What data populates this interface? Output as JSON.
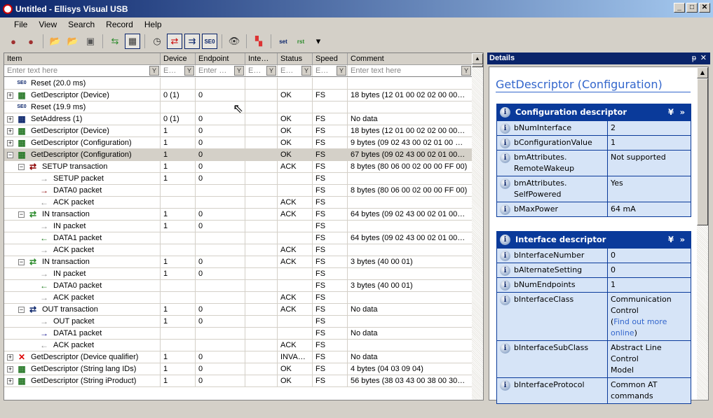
{
  "window": {
    "title": "Untitled - Ellisys Visual USB",
    "min": "_",
    "max": "□",
    "close": "✕"
  },
  "menu": [
    "File",
    "View",
    "Search",
    "Record",
    "Help"
  ],
  "toolbar": [
    {
      "icon": "record-icon",
      "g": "●",
      "c": "#a03030"
    },
    {
      "icon": "record-add-icon",
      "g": "●",
      "c": "#a03030"
    },
    {
      "sep": true
    },
    {
      "icon": "open-folder-icon",
      "g": "📂",
      "c": "#c8a030"
    },
    {
      "icon": "open-add-icon",
      "g": "📂",
      "c": "#c8a030"
    },
    {
      "icon": "save-icon",
      "g": "▣",
      "c": "#555"
    },
    {
      "sep": true
    },
    {
      "icon": "back-forward-icon",
      "g": "⇆",
      "c": "#2a8a2a"
    },
    {
      "icon": "transaction-view-icon",
      "g": "▦",
      "c": "#333",
      "on": true
    },
    {
      "sep": true
    },
    {
      "icon": "timer-icon",
      "g": "◷",
      "c": "#333"
    },
    {
      "icon": "transfer-icon",
      "g": "⇄",
      "c": "#c00",
      "on": true
    },
    {
      "icon": "split-icon",
      "g": "⇉",
      "c": "#0a246a",
      "on": true
    },
    {
      "icon": "seo-icon",
      "g": "SE0",
      "c": "#0a246a",
      "on": true
    },
    {
      "sep": true
    },
    {
      "icon": "binoculars-icon",
      "g": "👁",
      "c": "#333"
    },
    {
      "sep": true
    },
    {
      "icon": "colors-icon",
      "g": "▚",
      "c": "#d33"
    },
    {
      "sep": true
    },
    {
      "icon": "set-icon",
      "g": "set",
      "c": "#0a246a"
    },
    {
      "icon": "reset-icon",
      "g": "rst",
      "c": "#2a8a2a"
    },
    {
      "icon": "dropdown-icon",
      "g": "▾",
      "c": "#000"
    }
  ],
  "columns": [
    "Item",
    "Device",
    "Endpoint",
    "Inte…",
    "Status",
    "Speed",
    "Comment"
  ],
  "filters": [
    "Enter text here",
    "E…",
    "Enter …",
    "E…",
    "E…",
    "E…",
    "Enter text here"
  ],
  "rows": [
    [
      0,
      "",
      "seo",
      "Reset (20.0 ms)",
      "",
      "",
      "",
      "",
      "",
      ""
    ],
    [
      0,
      "+",
      "ctl-in",
      "GetDescriptor (Device)",
      "0 (1)",
      "0",
      "",
      "OK",
      "FS",
      "18 bytes (12 01 00 02 02 00 00…"
    ],
    [
      0,
      "",
      "seo",
      "Reset (19.9 ms)",
      "",
      "",
      "",
      "",
      "",
      ""
    ],
    [
      0,
      "+",
      "ctl-out",
      "SetAddress (1)",
      "0 (1)",
      "0",
      "",
      "OK",
      "FS",
      "No data"
    ],
    [
      0,
      "+",
      "ctl-in",
      "GetDescriptor (Device)",
      "1",
      "0",
      "",
      "OK",
      "FS",
      "18 bytes (12 01 00 02 02 00 00…"
    ],
    [
      0,
      "+",
      "ctl-in",
      "GetDescriptor (Configuration)",
      "1",
      "0",
      "",
      "OK",
      "FS",
      "9 bytes (09 02 43 00 02 01 00 …"
    ],
    [
      0,
      "-",
      "ctl-in",
      "GetDescriptor (Configuration)",
      "1",
      "0",
      "",
      "OK",
      "FS",
      "67 bytes (09 02 43 00 02 01 00…"
    ],
    [
      1,
      "-",
      "setup-tr",
      "SETUP transaction",
      "1",
      "0",
      "",
      "ACK",
      "FS",
      "8 bytes (80 06 00 02 00 00 FF 00)"
    ],
    [
      2,
      "",
      "gray-r",
      "SETUP packet",
      "1",
      "0",
      "",
      "",
      "FS",
      ""
    ],
    [
      2,
      "",
      "red-r",
      "DATA0 packet",
      "",
      "",
      "",
      "",
      "FS",
      "8 bytes (80 06 00 02 00 00 FF 00)"
    ],
    [
      2,
      "",
      "gray-l",
      "ACK packet",
      "",
      "",
      "",
      "ACK",
      "FS",
      ""
    ],
    [
      1,
      "-",
      "in-tr",
      "IN transaction",
      "1",
      "0",
      "",
      "ACK",
      "FS",
      "64 bytes (09 02 43 00 02 01 00…"
    ],
    [
      2,
      "",
      "gray-r",
      "IN packet",
      "1",
      "0",
      "",
      "",
      "FS",
      ""
    ],
    [
      2,
      "",
      "green-l",
      "DATA1 packet",
      "",
      "",
      "",
      "",
      "FS",
      "64 bytes (09 02 43 00 02 01 00…"
    ],
    [
      2,
      "",
      "gray-r",
      "ACK packet",
      "",
      "",
      "",
      "ACK",
      "FS",
      ""
    ],
    [
      1,
      "-",
      "in-tr",
      "IN transaction",
      "1",
      "0",
      "",
      "ACK",
      "FS",
      "3 bytes (40 00 01)"
    ],
    [
      2,
      "",
      "gray-r",
      "IN packet",
      "1",
      "0",
      "",
      "",
      "FS",
      ""
    ],
    [
      2,
      "",
      "green-l",
      "DATA0 packet",
      "",
      "",
      "",
      "",
      "FS",
      "3 bytes (40 00 01)"
    ],
    [
      2,
      "",
      "gray-r",
      "ACK packet",
      "",
      "",
      "",
      "ACK",
      "FS",
      ""
    ],
    [
      1,
      "-",
      "out-tr",
      "OUT transaction",
      "1",
      "0",
      "",
      "ACK",
      "FS",
      "No data"
    ],
    [
      2,
      "",
      "gray-r",
      "OUT packet",
      "1",
      "0",
      "",
      "",
      "FS",
      ""
    ],
    [
      2,
      "",
      "blue-r",
      "DATA1 packet",
      "",
      "",
      "",
      "",
      "FS",
      "No data"
    ],
    [
      2,
      "",
      "gray-l",
      "ACK packet",
      "",
      "",
      "",
      "ACK",
      "FS",
      ""
    ],
    [
      0,
      "+",
      "ctl-err",
      "GetDescriptor (Device qualifier)",
      "1",
      "0",
      "",
      "INVA…",
      "FS",
      "No data"
    ],
    [
      0,
      "+",
      "ctl-in",
      "GetDescriptor (String lang IDs)",
      "1",
      "0",
      "",
      "OK",
      "FS",
      "4 bytes (04 03 09 04)"
    ],
    [
      0,
      "+",
      "ctl-in",
      "GetDescriptor (String iProduct)",
      "1",
      "0",
      "",
      "OK",
      "FS",
      "56 bytes (38 03 43 00 38 00 30…"
    ]
  ],
  "selected_row": 6,
  "details": {
    "header": "Details",
    "pin": "ᵽ",
    "close": "✕",
    "title": "GetDescriptor (Configuration)",
    "sections": [
      {
        "title": "Configuration descriptor",
        "props": [
          [
            "bNumInterface",
            "2"
          ],
          [
            "bConfigurationValue",
            "1"
          ],
          [
            "bmAttributes.\nRemoteWakeup",
            "Not supported"
          ],
          [
            "bmAttributes.\nSelfPowered",
            "Yes"
          ],
          [
            "bMaxPower",
            "64 mA"
          ]
        ]
      },
      {
        "title": "Interface descriptor",
        "props": [
          [
            "bInterfaceNumber",
            "0"
          ],
          [
            "bAlternateSetting",
            "0"
          ],
          [
            "bNumEndpoints",
            "1"
          ],
          [
            "bInterfaceClass",
            "Communication\nControl"
          ],
          [
            "bInterfaceSubClass",
            "Abstract Line Control\nModel"
          ],
          [
            "bInterfaceProtocol",
            "Common AT\ncommands"
          ]
        ]
      }
    ],
    "link": "Find out more online"
  }
}
